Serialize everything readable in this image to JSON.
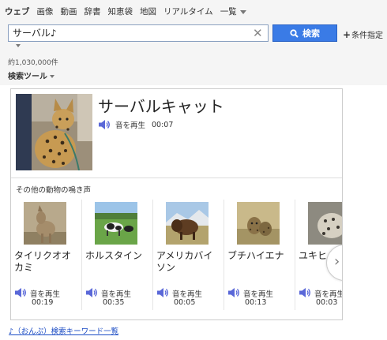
{
  "nav": {
    "tabs": [
      "ウェブ",
      "画像",
      "動画",
      "辞書",
      "知恵袋",
      "地図",
      "リアルタイム"
    ],
    "more_label": "一覧"
  },
  "search": {
    "query": "サーバル♪",
    "button_label": "検索",
    "conditions_label": "条件指定",
    "accent_color": "#3a7be6"
  },
  "results": {
    "count_text": "約1,030,000件",
    "tools_label": "検索ツール"
  },
  "card": {
    "main": {
      "title": "サーバルキャット",
      "play_label": "音を再生",
      "duration": "00:07"
    },
    "others_heading": "その他の動物の鳴き声",
    "animals": [
      {
        "name": "タイリクオオカミ",
        "play_label": "音を再生",
        "duration": "00:19"
      },
      {
        "name": "ホルスタイン",
        "play_label": "音を再生",
        "duration": "00:35"
      },
      {
        "name": "アメリカバイソン",
        "play_label": "音を再生",
        "duration": "00:05"
      },
      {
        "name": "ブチハイエナ",
        "play_label": "音を再生",
        "duration": "00:13"
      },
      {
        "name": "ユキヒョウ",
        "play_label": "音を再生",
        "duration": "00:03"
      }
    ]
  },
  "footer": {
    "link_text": "♪（おんぷ）検索キーワード一覧"
  }
}
